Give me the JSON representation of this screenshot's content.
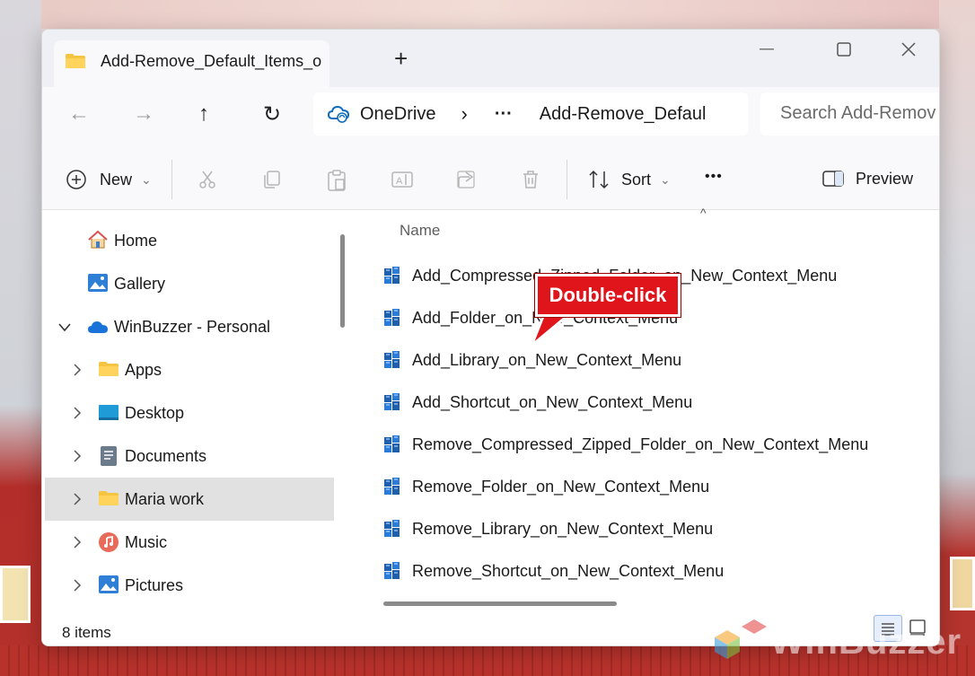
{
  "tab": {
    "title": "Add-Remove_Default_Items_o",
    "close": "×",
    "new_tab": "+"
  },
  "window_controls": {
    "minimize": "—",
    "maximize": "☐",
    "close": "✕"
  },
  "nav": {
    "back": "←",
    "forward": "→",
    "up": "↑",
    "refresh": "↻"
  },
  "address": {
    "root": "OneDrive",
    "sep1": "›",
    "overflow": "···",
    "current": "Add-Remove_Defaul"
  },
  "search": {
    "placeholder": "Search Add-Remov"
  },
  "toolbar": {
    "new_label": "New",
    "sort_label": "Sort",
    "more": "•••",
    "preview_label": "Preview",
    "dropdown": "⌄"
  },
  "sidebar": {
    "items": [
      {
        "label": "Home"
      },
      {
        "label": "Gallery"
      },
      {
        "label": "WinBuzzer - Personal"
      },
      {
        "label": "Apps"
      },
      {
        "label": "Desktop"
      },
      {
        "label": "Documents"
      },
      {
        "label": "Maria work"
      },
      {
        "label": "Music"
      },
      {
        "label": "Pictures"
      }
    ]
  },
  "content": {
    "column_name": "Name",
    "sort_caret": "^",
    "files": [
      {
        "name": "Add_Compressed_Zipped_Folder_on_New_Context_Menu"
      },
      {
        "name": "Add_Folder_on_New_Context_Menu"
      },
      {
        "name": "Add_Library_on_New_Context_Menu"
      },
      {
        "name": "Add_Shortcut_on_New_Context_Menu"
      },
      {
        "name": "Remove_Compressed_Zipped_Folder_on_New_Context_Menu"
      },
      {
        "name": "Remove_Folder_on_New_Context_Menu"
      },
      {
        "name": "Remove_Library_on_New_Context_Menu"
      },
      {
        "name": "Remove_Shortcut_on_New_Context_Menu"
      }
    ]
  },
  "status": {
    "count": "8 items"
  },
  "callout": {
    "text": "Double-click"
  },
  "watermark": {
    "text": "WinBuzzer"
  },
  "colors": {
    "callout_red": "#e0141b",
    "selection_gray": "#e1e1e1",
    "onedrive_blue": "#0f6cbd"
  }
}
